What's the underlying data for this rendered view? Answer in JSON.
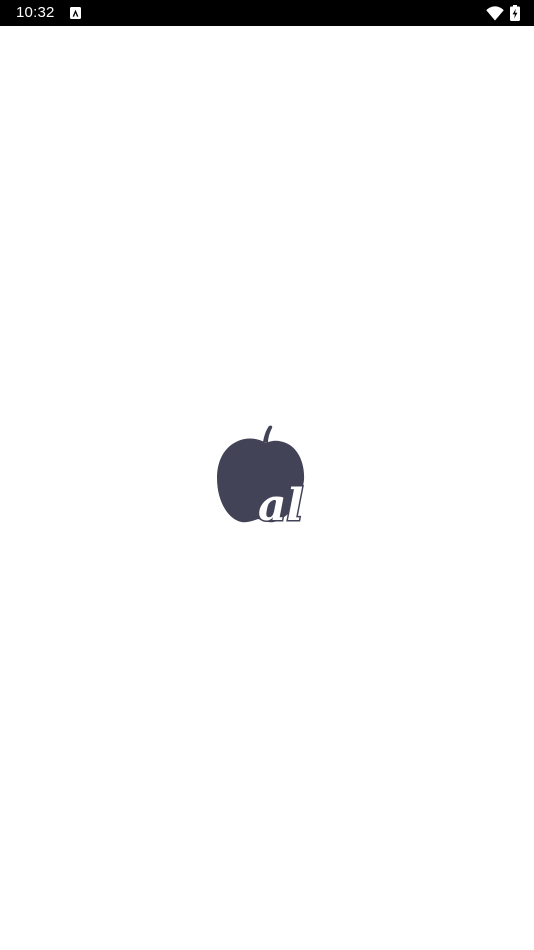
{
  "status_bar": {
    "time": "10:32",
    "notification_icon": "app-notification-icon",
    "wifi_icon": "wifi-icon",
    "battery_icon": "battery-charging-icon"
  },
  "splash": {
    "logo_icon": "apple-logo-icon",
    "logo_text": "al",
    "logo_color": "#434358",
    "background_color": "#ffffff"
  }
}
